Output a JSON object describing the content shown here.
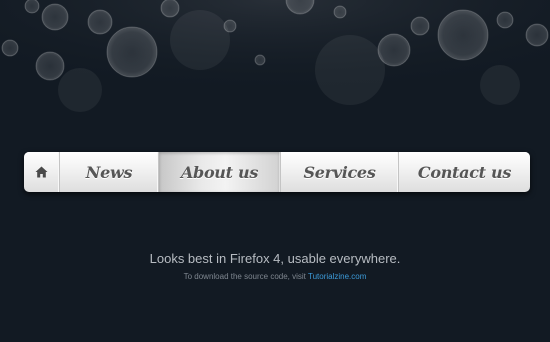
{
  "nav": {
    "home_icon": "home-icon",
    "items": [
      {
        "label": "News"
      },
      {
        "label": "About us",
        "active": true
      },
      {
        "label": "Services"
      },
      {
        "label": "Contact us"
      }
    ]
  },
  "footer": {
    "tagline": "Looks best in Firefox 4, usable everywhere.",
    "note_prefix": "To download the source code, visit",
    "link_text": "Tutorialzine.com"
  },
  "colors": {
    "background": "#121a23",
    "link": "#3c9ad8",
    "nav_text": "#565656"
  }
}
